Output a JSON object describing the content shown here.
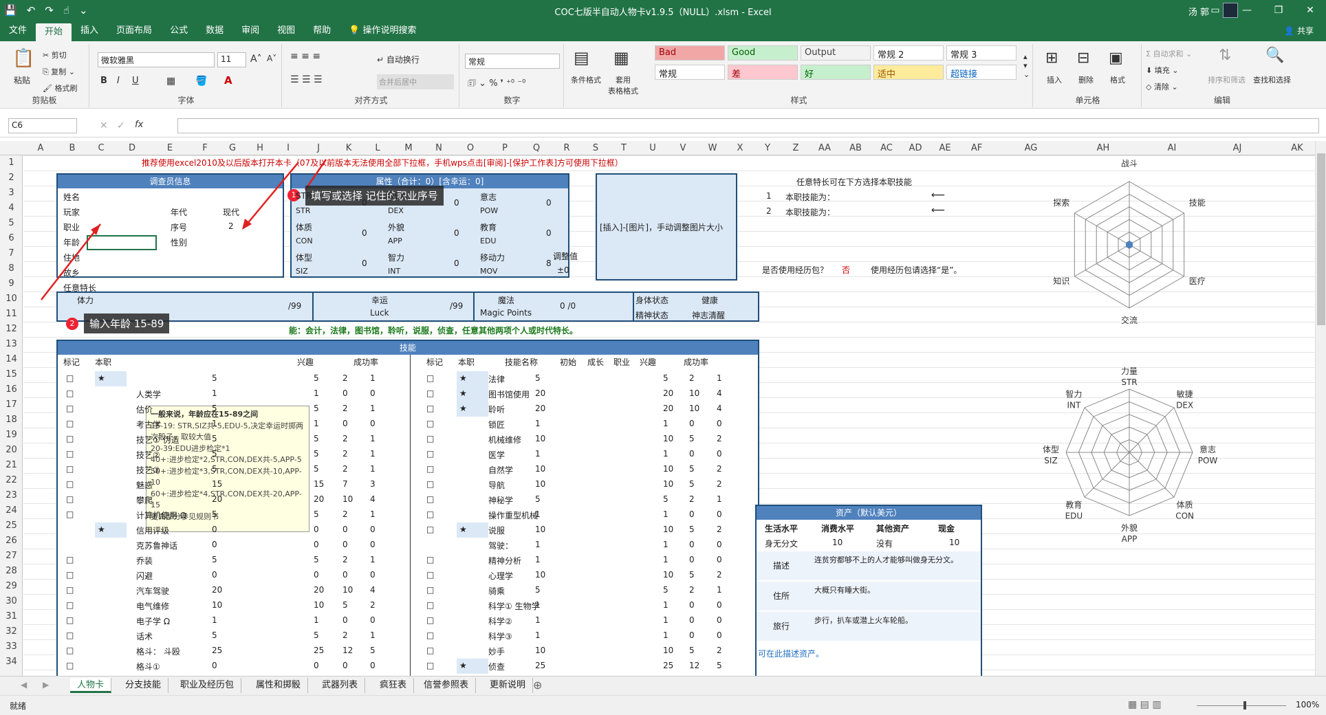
{
  "window": {
    "title": "COC七版半自动人物卡v1.9.5（NULL）.xlsm  -  Excel",
    "user": "汤 郭"
  },
  "ribbon_tabs": [
    "文件",
    "开始",
    "插入",
    "页面布局",
    "公式",
    "数据",
    "审阅",
    "视图",
    "帮助",
    "操作说明搜索"
  ],
  "share": "共享",
  "clipboard": {
    "paste": "粘贴",
    "cut": "剪切",
    "copy": "复制",
    "painter": "格式刷",
    "label": "剪贴板"
  },
  "font": {
    "name": "微软雅黑",
    "size": "11",
    "label": "字体",
    "bold": "B",
    "italic": "I",
    "underline": "U"
  },
  "align": {
    "wrap": "自动换行",
    "merge": "合并后居中",
    "label": "对齐方式"
  },
  "number": {
    "format": "常规",
    "label": "数字"
  },
  "styles": {
    "label": "样式",
    "cond": "条件格式",
    "table": "套用\n表格格式",
    "items": [
      {
        "t": "Bad",
        "bg": "#f2a7a7",
        "c": "#9c0006"
      },
      {
        "t": "Good",
        "bg": "#c6efce",
        "c": "#006100"
      },
      {
        "t": "Output",
        "bg": "#f2f2f2",
        "c": "#3f3f3f"
      },
      {
        "t": "常规 2",
        "bg": "#fff",
        "c": "#222"
      },
      {
        "t": "常规 3",
        "bg": "#fff",
        "c": "#222"
      },
      {
        "t": "常规",
        "bg": "#fff",
        "c": "#222"
      },
      {
        "t": "差",
        "bg": "#ffc7ce",
        "c": "#9c0006"
      },
      {
        "t": "好",
        "bg": "#c6efce",
        "c": "#006100"
      },
      {
        "t": "适中",
        "bg": "#ffeb9c",
        "c": "#9c5700"
      },
      {
        "t": "超链接",
        "bg": "#fff",
        "c": "#0563c1"
      }
    ]
  },
  "cells": {
    "label": "单元格",
    "insert": "插入",
    "delete": "删除",
    "format": "格式"
  },
  "edit": {
    "label": "编辑",
    "autosum": "自动求和",
    "fill": "填充",
    "clear": "清除",
    "sort": "排序和筛选",
    "find": "查找和选择"
  },
  "namebox": "C6",
  "columns": [
    "A",
    "B",
    "C",
    "D",
    "E",
    "F",
    "G",
    "H",
    "I",
    "J",
    "K",
    "L",
    "M",
    "N",
    "O",
    "P",
    "Q",
    "R",
    "S",
    "T",
    "U",
    "V",
    "W",
    "X",
    "Y",
    "Z",
    "AA",
    "AB",
    "AC",
    "AD",
    "AE",
    "AF",
    "AG",
    "AH",
    "AI",
    "AJ",
    "AK",
    "AL",
    "AM"
  ],
  "rows": [
    "1",
    "2",
    "3",
    "4",
    "5",
    "6",
    "7",
    "8",
    "9",
    "10",
    "11",
    "12",
    "13",
    "14",
    "15",
    "16",
    "17",
    "18",
    "19",
    "20",
    "21",
    "22",
    "23",
    "24",
    "25",
    "26",
    "27",
    "28",
    "29",
    "30",
    "31",
    "32",
    "33",
    "34"
  ],
  "notice": "推荐使用excel2010及以后版本打开本卡（07及以前版本无法使用全部下拉框，手机wps点击[审阅]-[保护工作表]方可使用下拉框）",
  "investigator": {
    "title": "调查员信息",
    "name": "姓名",
    "player": "玩家",
    "era": "年代",
    "era_val": "现代",
    "job": "职业",
    "seq": "序号",
    "seq_val": "2",
    "age": "年龄",
    "sex": "性别",
    "home": "住地",
    "hometown": "故乡"
  },
  "attr": {
    "title": "属性（合计：0）[含幸运：0]",
    "items": [
      [
        "STR",
        "0"
      ],
      [
        "DEX",
        "0"
      ],
      [
        "意志",
        "0"
      ],
      [
        "体质",
        "0"
      ],
      [
        "外貌",
        "0"
      ],
      [
        "教育",
        "0"
      ],
      [
        "体型",
        "0"
      ],
      [
        "智力",
        "0"
      ],
      [
        "移动力",
        "8"
      ]
    ],
    "sub": [
      "STR",
      "DEX",
      "POW",
      "CON",
      "APP",
      "EDU",
      "SIZ",
      "INT",
      "MOV"
    ],
    "adjust": "调整值",
    "adjust_val": "±0"
  },
  "picture": "[插入]-[图片]，手动调整图片大小",
  "right": {
    "skill_title": "任意特长可在下方选择本职技能",
    "line1_n": "1",
    "line1": "本职技能为：",
    "line2_n": "2",
    "line2": "本职技能为：",
    "arrow": "⟵",
    "q": "是否使用经历包？",
    "q_val": "否",
    "hint": "使用经历包请选择“是”。"
  },
  "status_row": {
    "hp": "体力",
    "hp_div": "/99",
    "luck": "幸运",
    "luck_en": "Luck",
    "luck_div": "/99",
    "mp": "魔法",
    "mp_en": "Magic Points",
    "mp_val": "0 /0",
    "body": "身体状态",
    "body_val": "健康",
    "mind": "精神状态",
    "mind_val": "神志清醒",
    "spec": "任意特长"
  },
  "green_note": "能：会计，法律，图书馆，聆听，说服，侦查，任意其他两项个人或时代特长。",
  "skills": {
    "title": "技能",
    "headers_l": [
      "标记",
      "本职",
      "",
      "",
      "",
      "",
      "兴趣",
      "",
      "成功率"
    ],
    "headers_r": [
      "标记",
      "本职",
      "技能名称",
      "初始",
      "成长",
      "职业",
      "兴趣",
      "成功率"
    ],
    "left": [
      [
        "□",
        "★",
        "",
        "5",
        "5",
        "2",
        "1"
      ],
      [
        "□",
        "",
        "人类学",
        "1",
        "1",
        "0",
        "0"
      ],
      [
        "□",
        "",
        "估价",
        "5",
        "5",
        "2",
        "1"
      ],
      [
        "□",
        "",
        "考古学",
        "1",
        "1",
        "0",
        "0"
      ],
      [
        "□",
        "",
        "技艺① 伪造",
        "5",
        "5",
        "2",
        "1"
      ],
      [
        "□",
        "",
        "技艺②",
        "5",
        "5",
        "2",
        "1"
      ],
      [
        "□",
        "",
        "技艺③",
        "5",
        "5",
        "2",
        "1"
      ],
      [
        "□",
        "",
        "魅惑",
        "15",
        "15",
        "7",
        "3"
      ],
      [
        "□",
        "",
        "攀爬",
        "20",
        "20",
        "10",
        "4"
      ],
      [
        "□",
        "",
        "计算机使用 Ω",
        "5",
        "5",
        "2",
        "1"
      ],
      [
        "",
        "★",
        "信用评级",
        "0",
        "0",
        "0",
        "0"
      ],
      [
        "",
        "",
        "克苏鲁神话",
        "0",
        "0",
        "0",
        "0"
      ],
      [
        "□",
        "",
        "乔装",
        "5",
        "5",
        "2",
        "1"
      ],
      [
        "□",
        "",
        "闪避",
        "0",
        "0",
        "0",
        "0"
      ],
      [
        "□",
        "",
        "汽车驾驶",
        "20",
        "20",
        "10",
        "4"
      ],
      [
        "□",
        "",
        "电气维修",
        "10",
        "10",
        "5",
        "2"
      ],
      [
        "□",
        "",
        "电子学 Ω",
        "1",
        "1",
        "0",
        "0"
      ],
      [
        "□",
        "",
        "话术",
        "5",
        "5",
        "2",
        "1"
      ],
      [
        "□",
        "",
        "格斗：  斗殴",
        "25",
        "25",
        "12",
        "5"
      ],
      [
        "□",
        "",
        "格斗①",
        "0",
        "0",
        "0",
        "0"
      ]
    ],
    "right": [
      [
        "□",
        "★",
        "法律",
        "5",
        "5",
        "2",
        "1"
      ],
      [
        "□",
        "★",
        "图书馆使用",
        "20",
        "20",
        "10",
        "4"
      ],
      [
        "□",
        "★",
        "聆听",
        "20",
        "20",
        "10",
        "4"
      ],
      [
        "□",
        "",
        "锁匠",
        "1",
        "1",
        "0",
        "0"
      ],
      [
        "□",
        "",
        "机械维修",
        "10",
        "10",
        "5",
        "2"
      ],
      [
        "□",
        "",
        "医学",
        "1",
        "1",
        "0",
        "0"
      ],
      [
        "□",
        "",
        "自然学",
        "10",
        "10",
        "5",
        "2"
      ],
      [
        "□",
        "",
        "导航",
        "10",
        "10",
        "5",
        "2"
      ],
      [
        "□",
        "",
        "神秘学",
        "5",
        "5",
        "2",
        "1"
      ],
      [
        "□",
        "",
        "操作重型机械",
        "1",
        "1",
        "0",
        "0"
      ],
      [
        "□",
        "★",
        "说服",
        "10",
        "10",
        "5",
        "2"
      ],
      [
        "",
        "",
        "驾驶：",
        "1",
        "1",
        "0",
        "0"
      ],
      [
        "□",
        "",
        "精神分析",
        "1",
        "1",
        "0",
        "0"
      ],
      [
        "□",
        "",
        "心理学",
        "10",
        "10",
        "5",
        "2"
      ],
      [
        "□",
        "",
        "骑乘",
        "5",
        "5",
        "2",
        "1"
      ],
      [
        "□",
        "",
        "科学① 生物学",
        "1",
        "1",
        "0",
        "0"
      ],
      [
        "□",
        "",
        "科学②",
        "1",
        "1",
        "0",
        "0"
      ],
      [
        "□",
        "",
        "科学③",
        "1",
        "1",
        "0",
        "0"
      ],
      [
        "□",
        "",
        "妙手",
        "10",
        "10",
        "5",
        "2"
      ],
      [
        "□",
        "★",
        "侦查",
        "25",
        "25",
        "12",
        "5"
      ]
    ]
  },
  "tooltip": [
    "一般来说，年龄应在15-89之间",
    "15-19: STR,SIZ共-5,EDU-5,决定幸运时掷两次骰子，取较大值",
    "20-39:EDU进步检定*1",
    "40+:进步检定*2,STR,CON,DEX共-5,APP-5",
    "50+:进步检定*3,STR,CON,DEX共-10,APP-10",
    "60+:进步检定*4,STR,CON,DEX共-20,APP-15",
    "更高部分参见规则书"
  ],
  "annotations": [
    {
      "n": "1",
      "t": "填写或选择 记住的职业序号"
    },
    {
      "n": "2",
      "t": "输入年龄 15-89"
    }
  ],
  "radar1": {
    "labels": [
      "战斗",
      "技能",
      "医疗",
      "交流",
      "知识",
      "探索"
    ]
  },
  "radar2": {
    "labels": [
      [
        "力量",
        "STR"
      ],
      [
        "敏捷",
        "DEX"
      ],
      [
        "意志",
        "POW"
      ],
      [
        "体质",
        "CON"
      ],
      [
        "外貌",
        "APP"
      ],
      [
        "教育",
        "EDU"
      ],
      [
        "体型",
        "SIZ"
      ],
      [
        "智力",
        "INT"
      ]
    ]
  },
  "assets": {
    "title": "资产（默认美元）",
    "h": [
      "生活水平",
      "消费水平",
      "其他资产",
      "现金"
    ],
    "v": [
      "身无分文",
      "10",
      "没有",
      "10"
    ],
    "desc_l": "描述",
    "desc": "连贫穷都够不上的人才能够叫做身无分文。",
    "home_l": "住所",
    "home": "大概只有睡大街。",
    "travel_l": "旅行",
    "travel": "步行，扒车或潜上火车轮船。",
    "note": "可在此描述资产。"
  },
  "sheets": [
    "人物卡",
    "分支技能",
    "职业及经历包",
    "属性和掷骰",
    "武器列表",
    "疯狂表",
    "信誉参照表",
    "更新说明"
  ],
  "status": {
    "ready": "就绪",
    "zoom": "100%"
  }
}
